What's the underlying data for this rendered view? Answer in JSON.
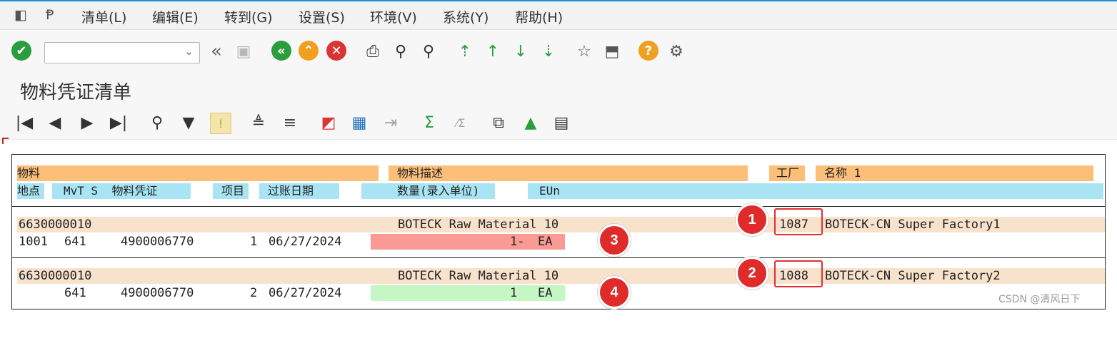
{
  "menu": {
    "items": [
      "清单(L)",
      "编辑(E)",
      "转到(G)",
      "设置(S)",
      "环境(V)",
      "系统(Y)",
      "帮助(H)"
    ]
  },
  "toolbar": {
    "command_value": "",
    "icons": [
      "enter-icon",
      "back-icon",
      "save-icon",
      "green-back-icon",
      "exit-icon",
      "cancel-icon",
      "print-icon",
      "find-icon",
      "find-next-icon",
      "first-page-icon",
      "previous-page-icon",
      "next-page-icon",
      "last-page-icon",
      "create-session-icon",
      "shortcut-icon",
      "help-icon",
      "settings-icon"
    ]
  },
  "title": "物料凭证清单",
  "alv_icons": [
    "first-row-icon",
    "previous-row-icon",
    "next-row-icon",
    "last-row-icon",
    "details-icon",
    "filter-icon",
    "warning-icon",
    "sort-ascending-icon",
    "sort-descending-icon",
    "layout-icon",
    "columns-icon",
    "export-icon",
    "sum-icon",
    "subtotal-icon",
    "graphic-icon",
    "chart-icon",
    "abc-icon"
  ],
  "header": {
    "row1": {
      "material": "物料",
      "description": "物料描述",
      "plant": "工厂",
      "name": "名称 1"
    },
    "row2": {
      "location": "地点",
      "mvt": "MvT S",
      "doc": "物料凭证",
      "item": "项目",
      "date": "过账日期",
      "qty": "数量(录入单位)",
      "eun": "EUn"
    }
  },
  "rows": [
    {
      "material": "6630000010",
      "description": "BOTECK Raw Material 10",
      "plant": "1087",
      "name": "BOTECK-CN Super Factory1",
      "location": "1001",
      "mvt": "641",
      "doc": "4900006770",
      "item": "1",
      "date": "06/27/2024",
      "qty": "1-",
      "unit": "EA",
      "qty_color": "#f99b94"
    },
    {
      "material": "6630000010",
      "description": "BOTECK Raw Material 10",
      "plant": "1088",
      "name": "BOTECK-CN Super Factory2",
      "location": "",
      "mvt": "641",
      "doc": "4900006770",
      "item": "2",
      "date": "06/27/2024",
      "qty": "1",
      "unit": "EA",
      "qty_color": "#c5f7c5"
    }
  ],
  "badges": [
    "1",
    "2",
    "3",
    "4"
  ],
  "watermark": "CSDN @清风日下",
  "colors": {
    "accent": "#1f8fd7",
    "header_orange": "#fbbf7a",
    "header_cyan": "#a8e4f4",
    "row": "#f8e2cc",
    "badge": "#e02b2b"
  }
}
